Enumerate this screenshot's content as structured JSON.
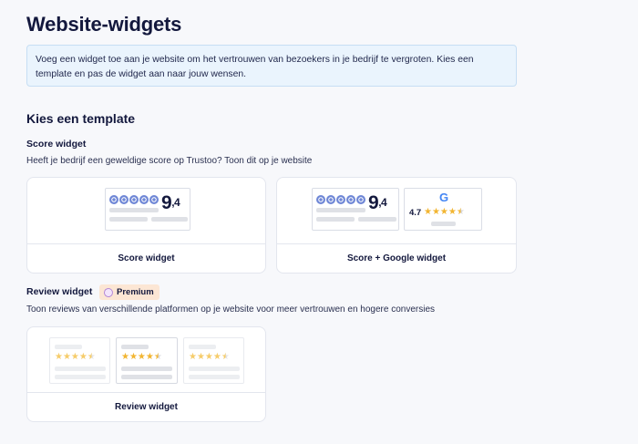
{
  "page": {
    "title": "Website-widgets",
    "info_text": "Voeg een widget toe aan je website om het vertrouwen van bezoekers in je bedrijf te vergroten. Kies een template en pas de widget aan naar jouw wensen."
  },
  "templates": {
    "heading": "Kies een template",
    "score_section": {
      "title": "Score widget",
      "description": "Heeft je bedrijf een geweldige score op Trustoo? Toon dit op je website",
      "cards": [
        {
          "label": "Score widget",
          "score_int": "9",
          "score_dec": ",4"
        },
        {
          "label": "Score + Google widget",
          "score_int": "9",
          "score_dec": ",4",
          "google_rating": "4.7",
          "google_letter": "G"
        }
      ]
    },
    "review_section": {
      "title": "Review widget",
      "badge": "Premium",
      "badge_icon": "premium-tag-icon",
      "description": "Toon reviews van verschillende platformen op je website voor meer vertrouwen en hogere conversies",
      "cards": [
        {
          "label": "Review widget"
        }
      ]
    }
  },
  "colors": {
    "accent_blue": "#6f87d6",
    "star": "#f2b531",
    "info_bg": "#eaf4fd",
    "badge_bg": "#fce6d4"
  }
}
